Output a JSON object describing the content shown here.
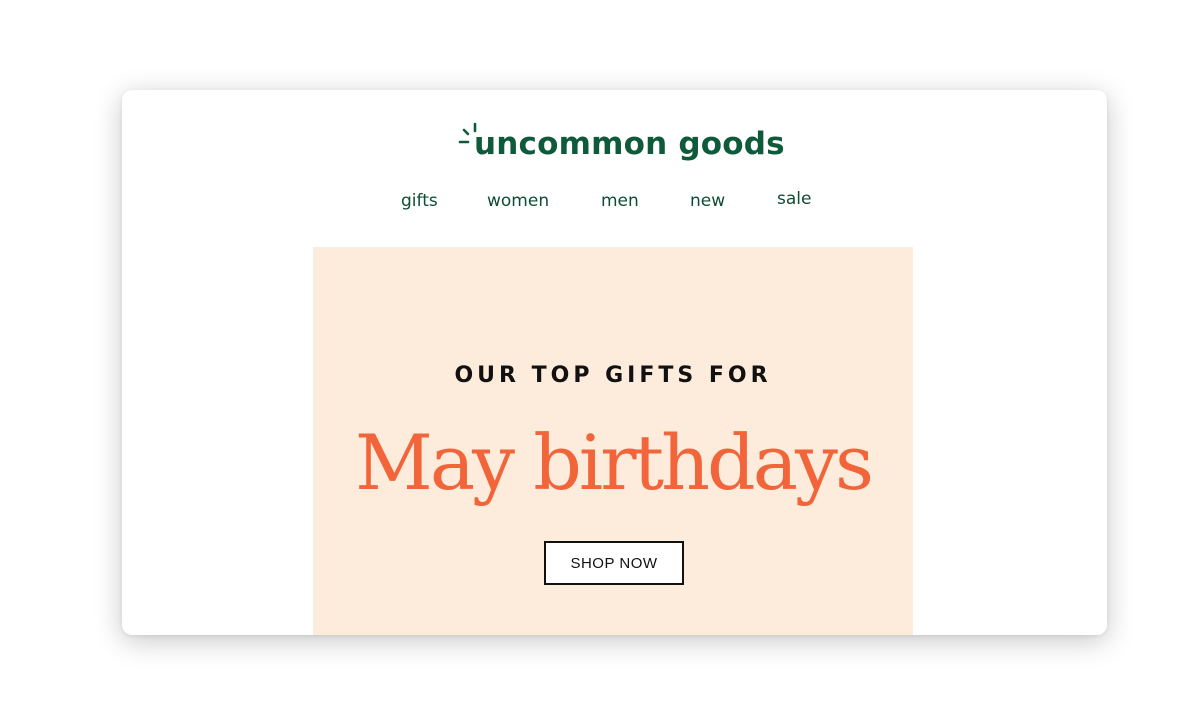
{
  "brand": {
    "name": "uncommon goods",
    "logo_icon": "sunburst-icon",
    "color": "#0e5a3a"
  },
  "nav": {
    "items": [
      {
        "label": "gifts"
      },
      {
        "label": "women"
      },
      {
        "label": "men"
      },
      {
        "label": "new"
      },
      {
        "label": "sale"
      }
    ]
  },
  "hero": {
    "eyebrow": "OUR TOP GIFTS FOR",
    "headline": "May birthdays",
    "cta_label": "SHOP NOW",
    "background": "#fdebdb",
    "headline_color": "#f2643a"
  }
}
